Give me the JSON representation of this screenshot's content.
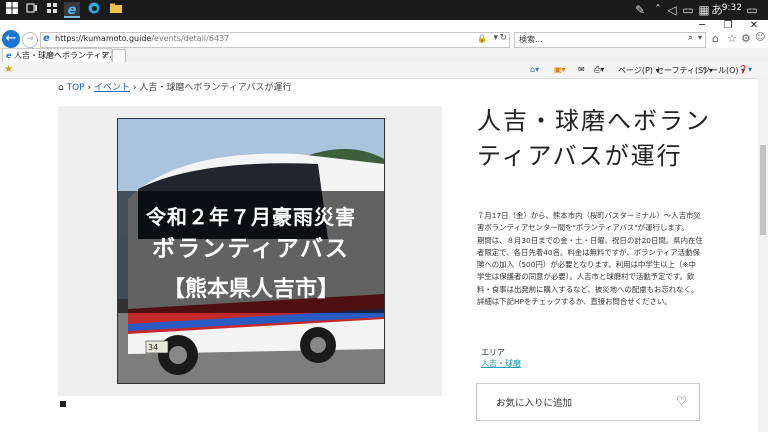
{
  "taskbar": {
    "time": "9:32",
    "icons": [
      "windows-start",
      "task-view",
      "ie",
      "edge",
      "file-explorer"
    ]
  },
  "browser": {
    "url_host": "https://kumamoto.guide",
    "url_path": "/events/detail/6437",
    "search_placeholder": "検索...",
    "tab_title": "人吉・球磨へボランティアバスが...",
    "tab_close": "×",
    "command": {
      "page": "ページ(P) ▾",
      "safety": "セーフティ(S) ▾",
      "tools": "ツール(O) ▾"
    }
  },
  "breadcrumb": {
    "home": "TOP",
    "sep": "›",
    "events": "イベント",
    "current": "人吉・球磨へボランティアバスが運行"
  },
  "image": {
    "line1": "令和２年７月豪雨災害",
    "line2": "ボランティアバス",
    "line3": "【熊本県人吉市】",
    "plate": "34"
  },
  "title": "人吉・球磨へボランティアバスが運行",
  "description": "７月17日（金）から、熊本市内（桜町バスターミナル）～人吉市災害ボランティアセンター間を\"ボランティアバス\"が運行します。\n期間は、８月30日までの金・土・日曜、祝日の計20日間。県内在住者限定で、各日先着40名。料金は無料ですが、ボランティア活動保険への加入（500円）が必要となります。利用は中学生以上（※中学生は保護者の同意が必要）。人吉市と球磨村で活動予定です。飲料・食事は出発前に購入するなど、被災地への配慮もお忘れなく。詳細は下記HPをチェックするか、直接お問合せください。",
  "area": {
    "label": "エリア",
    "value": "人吉・球磨"
  },
  "favorite": {
    "label": "お気に入りに追加"
  },
  "colors": {
    "link": "#1a62c0",
    "area_link": "#1a9bb0",
    "ie_blue": "#1b74d6"
  }
}
